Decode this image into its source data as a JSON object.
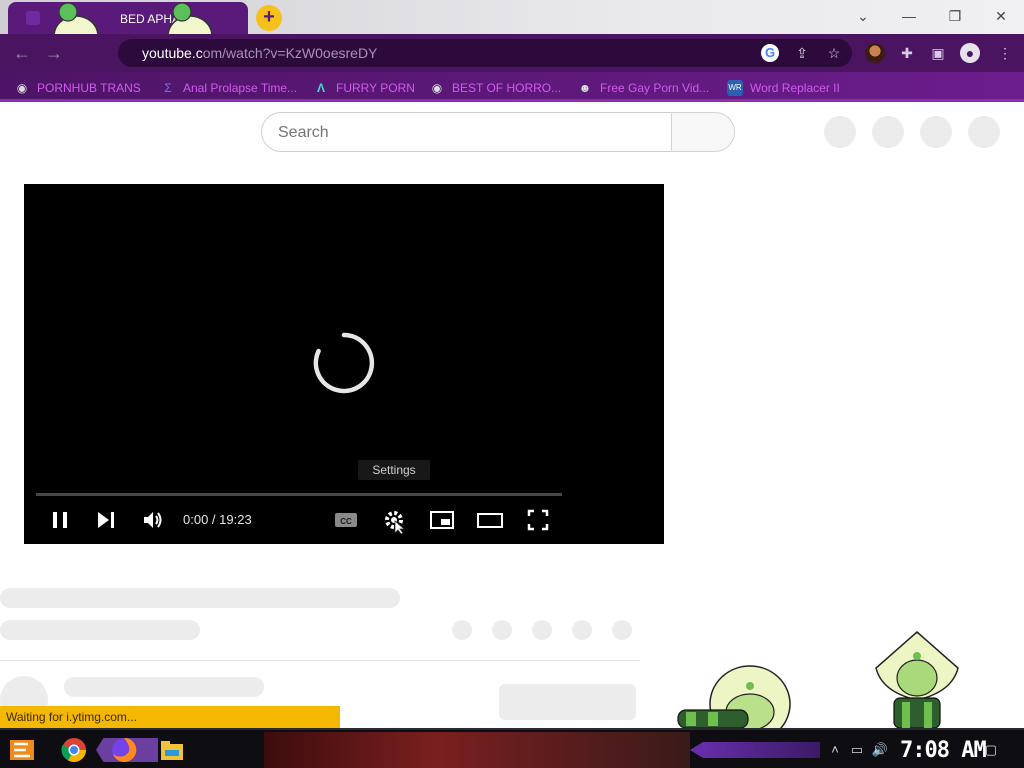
{
  "browser": {
    "tab_title": "BED APHA",
    "new_tab_symbol": "+",
    "url_host": "youtube.c",
    "url_rest": "om/watch?v=KzW0oesreDY",
    "window_controls": {
      "dropdown": "⌄",
      "minimize": "—",
      "restore": "❐",
      "close": "✕"
    }
  },
  "bookmarks": [
    {
      "label": "PORNHUB TRANS",
      "icon": "globe-icon"
    },
    {
      "label": "Anal Prolapse Time...",
      "icon": "sigma-icon"
    },
    {
      "label": "FURRY PORN",
      "icon": "lambda-icon"
    },
    {
      "label": "BEST OF HORRO...",
      "icon": "globe-icon"
    },
    {
      "label": "Free Gay Porn Vid...",
      "icon": "mask-icon"
    },
    {
      "label": "Word Replacer II",
      "icon": "wr-icon"
    }
  ],
  "page": {
    "search_placeholder": "Search"
  },
  "player": {
    "tooltip": "Settings",
    "time": "0:00 / 19:23",
    "progress": 0
  },
  "status_bar": "Waiting for i.ytimg.com...",
  "taskbar": {
    "clock": "7:08 AM"
  },
  "colors": {
    "toolbar": "#4a1460",
    "bookmark_text": "#d35af0",
    "status": "#f5b800"
  }
}
